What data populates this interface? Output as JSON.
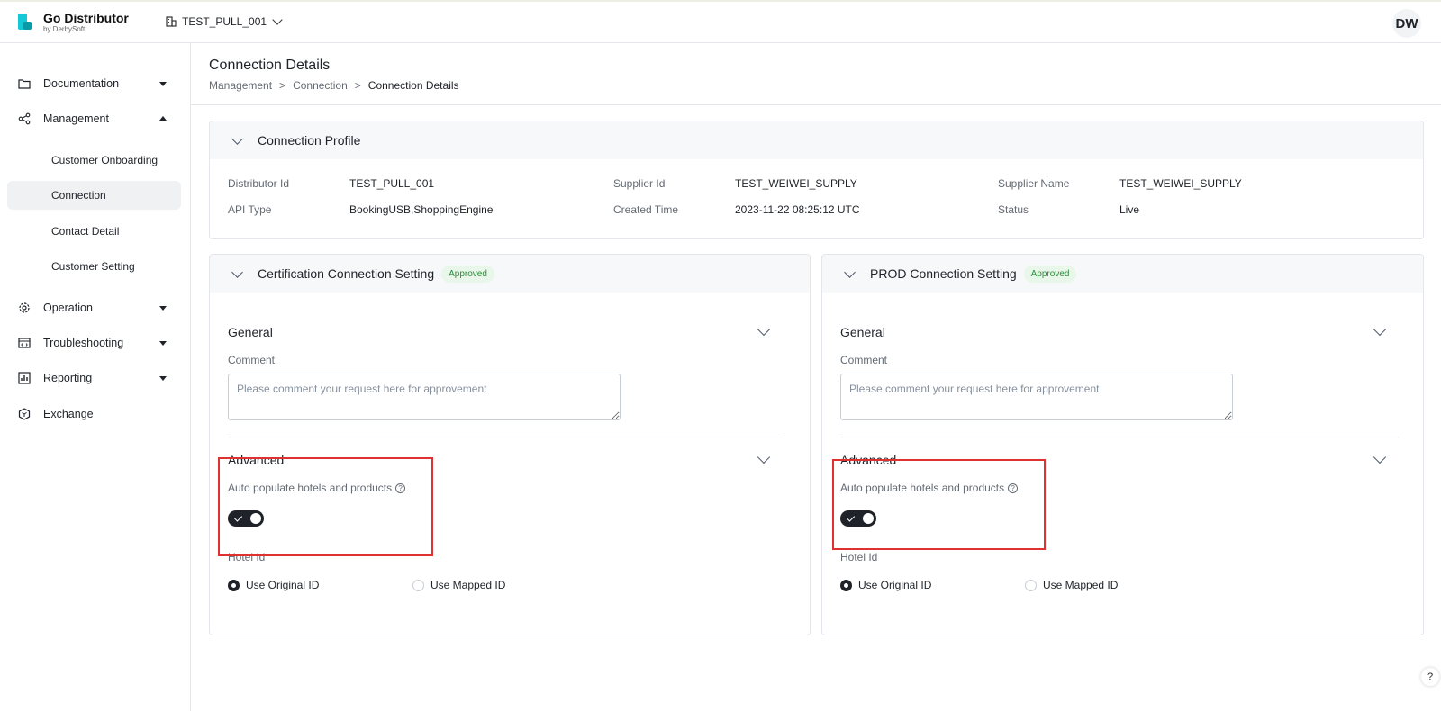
{
  "app": {
    "title": "Go Distributor",
    "subtitle": "by DerbySoft",
    "tenant": "TEST_PULL_001",
    "avatar": "DW"
  },
  "sidebar": {
    "items": [
      {
        "label": "Documentation",
        "icon": "folder-icon"
      },
      {
        "label": "Management",
        "icon": "share-icon"
      },
      {
        "label": "Operation",
        "icon": "gear-icon"
      },
      {
        "label": "Troubleshooting",
        "icon": "code-window-icon"
      },
      {
        "label": "Reporting",
        "icon": "bar-chart-icon"
      },
      {
        "label": "Exchange",
        "icon": "hexagon-icon"
      }
    ],
    "management_sub": [
      "Customer Onboarding",
      "Connection",
      "Contact Detail",
      "Customer Setting"
    ]
  },
  "page": {
    "title": "Connection Details",
    "breadcrumb": [
      "Management",
      "Connection",
      "Connection Details"
    ],
    "breadcrumb_sep": ">"
  },
  "profile": {
    "title": "Connection Profile",
    "fields": {
      "distributor_id": {
        "label": "Distributor Id",
        "value": "TEST_PULL_001"
      },
      "supplier_id": {
        "label": "Supplier Id",
        "value": "TEST_WEIWEI_SUPPLY"
      },
      "supplier_name": {
        "label": "Supplier Name",
        "value": "TEST_WEIWEI_SUPPLY"
      },
      "api_type": {
        "label": "API Type",
        "value": "BookingUSB,ShoppingEngine"
      },
      "created_time": {
        "label": "Created Time",
        "value": "2023-11-22 08:25:12 UTC"
      },
      "status": {
        "label": "Status",
        "value": "Live"
      }
    }
  },
  "cert": {
    "title": "Certification Connection Setting",
    "badge": "Approved",
    "general": "General",
    "comment_label": "Comment",
    "comment_placeholder": "Please comment your request here for approvement",
    "advanced": "Advanced",
    "auto_populate": "Auto populate hotels and products",
    "auto_populate_on": true,
    "hotel_id": "Hotel Id",
    "opt_original": "Use Original ID",
    "opt_mapped": "Use Mapped ID"
  },
  "prod": {
    "title": "PROD Connection Setting",
    "badge": "Approved",
    "general": "General",
    "comment_label": "Comment",
    "comment_placeholder": "Please comment your request here for approvement",
    "advanced": "Advanced",
    "auto_populate": "Auto populate hotels and products",
    "auto_populate_on": true,
    "hotel_id": "Hotel Id",
    "opt_original": "Use Original ID",
    "opt_mapped": "Use Mapped ID"
  },
  "help_glyph": "?",
  "colors": {
    "accent": "#14c8d6",
    "badge_bg": "#e8f7ea",
    "badge_text": "#2e8b3a",
    "highlight": "#e03131"
  }
}
